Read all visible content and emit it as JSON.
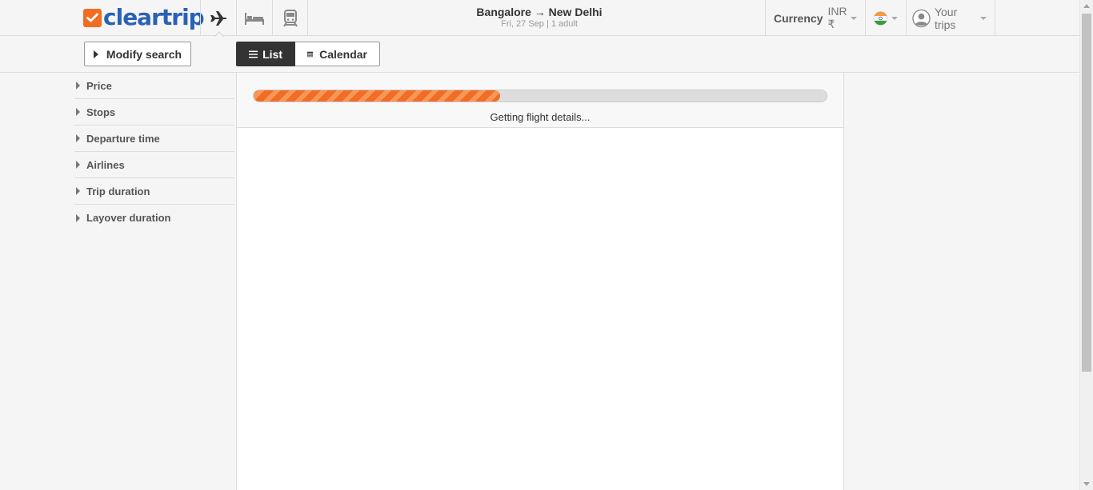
{
  "header": {
    "logo_text": "cleartrip",
    "route_title": "Bangalore → New Delhi",
    "route_subtitle": "Fri, 27 Sep | 1 adult",
    "currency_label": "Currency",
    "currency_value": "INR ₹",
    "trips_label": "Your trips",
    "nav": [
      {
        "name": "flights",
        "icon": "plane-icon",
        "active": true
      },
      {
        "name": "hotels",
        "icon": "bed-icon",
        "active": false
      },
      {
        "name": "trains",
        "icon": "train-icon",
        "active": false
      }
    ]
  },
  "toolbar": {
    "modify_label": "Modify search",
    "list_label": "List",
    "calendar_label": "Calendar",
    "active_view": "List"
  },
  "filters": {
    "items": [
      "Price",
      "Stops",
      "Departure time",
      "Airlines",
      "Trip duration",
      "Layover duration"
    ]
  },
  "results": {
    "progress_text": "Getting flight details...",
    "progress_fraction": 0.43
  },
  "colors": {
    "brand_orange": "#f26c22",
    "brand_blue": "#2a61b5"
  }
}
